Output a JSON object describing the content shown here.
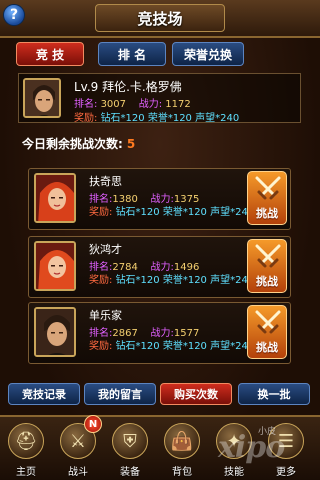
{
  "header": {
    "title": "竞技场",
    "help_label": "?"
  },
  "tabs": [
    {
      "label": "竞 技"
    },
    {
      "label": "排 名"
    },
    {
      "label": "荣誉兑换"
    }
  ],
  "player": {
    "name": "Lv.9 拜伦.卡.格罗佛",
    "rank_label": "排名:",
    "rank": "3007",
    "power_label": "战力:",
    "power": "1172",
    "reward_label": "奖励:",
    "rewards": "钻石*120 荣誉*120 声望*240"
  },
  "remaining": {
    "label": "今日剩余挑战次数:",
    "count": "5"
  },
  "opponents": [
    {
      "name": "扶奇思",
      "rank_label": "排名:",
      "rank": "1380",
      "power_label": "战力:",
      "power": "1375",
      "reward_label": "奖励:",
      "rewards": "钻石*120 荣誉*120 声望*240",
      "button": "挑战"
    },
    {
      "name": "狄鸿才",
      "rank_label": "排名:",
      "rank": "2784",
      "power_label": "战力:",
      "power": "1496",
      "reward_label": "奖励:",
      "rewards": "钻石*120 荣誉*120 声望*240",
      "button": "挑战"
    },
    {
      "name": "单乐家",
      "rank_label": "排名:",
      "rank": "2867",
      "power_label": "战力:",
      "power": "1577",
      "reward_label": "奖励:",
      "rewards": "钻石*120 荣誉*120 声望*240",
      "button": "挑战"
    }
  ],
  "actions": [
    {
      "label": "竞技记录"
    },
    {
      "label": "我的留言"
    },
    {
      "label": "购买次数"
    },
    {
      "label": "换一批"
    }
  ],
  "nav": [
    {
      "label": "主页"
    },
    {
      "label": "战斗"
    },
    {
      "label": "装备"
    },
    {
      "label": "背包"
    },
    {
      "label": "技能"
    },
    {
      "label": "更多"
    }
  ],
  "badge": "N",
  "watermark": "xipo",
  "watermark_small": "小皮",
  "colors": {
    "accent_red": "#cf2d1e",
    "accent_blue": "#2a4c82",
    "gold": "#f4d070",
    "pink": "#e060ff",
    "orange": "#ff7a20"
  }
}
